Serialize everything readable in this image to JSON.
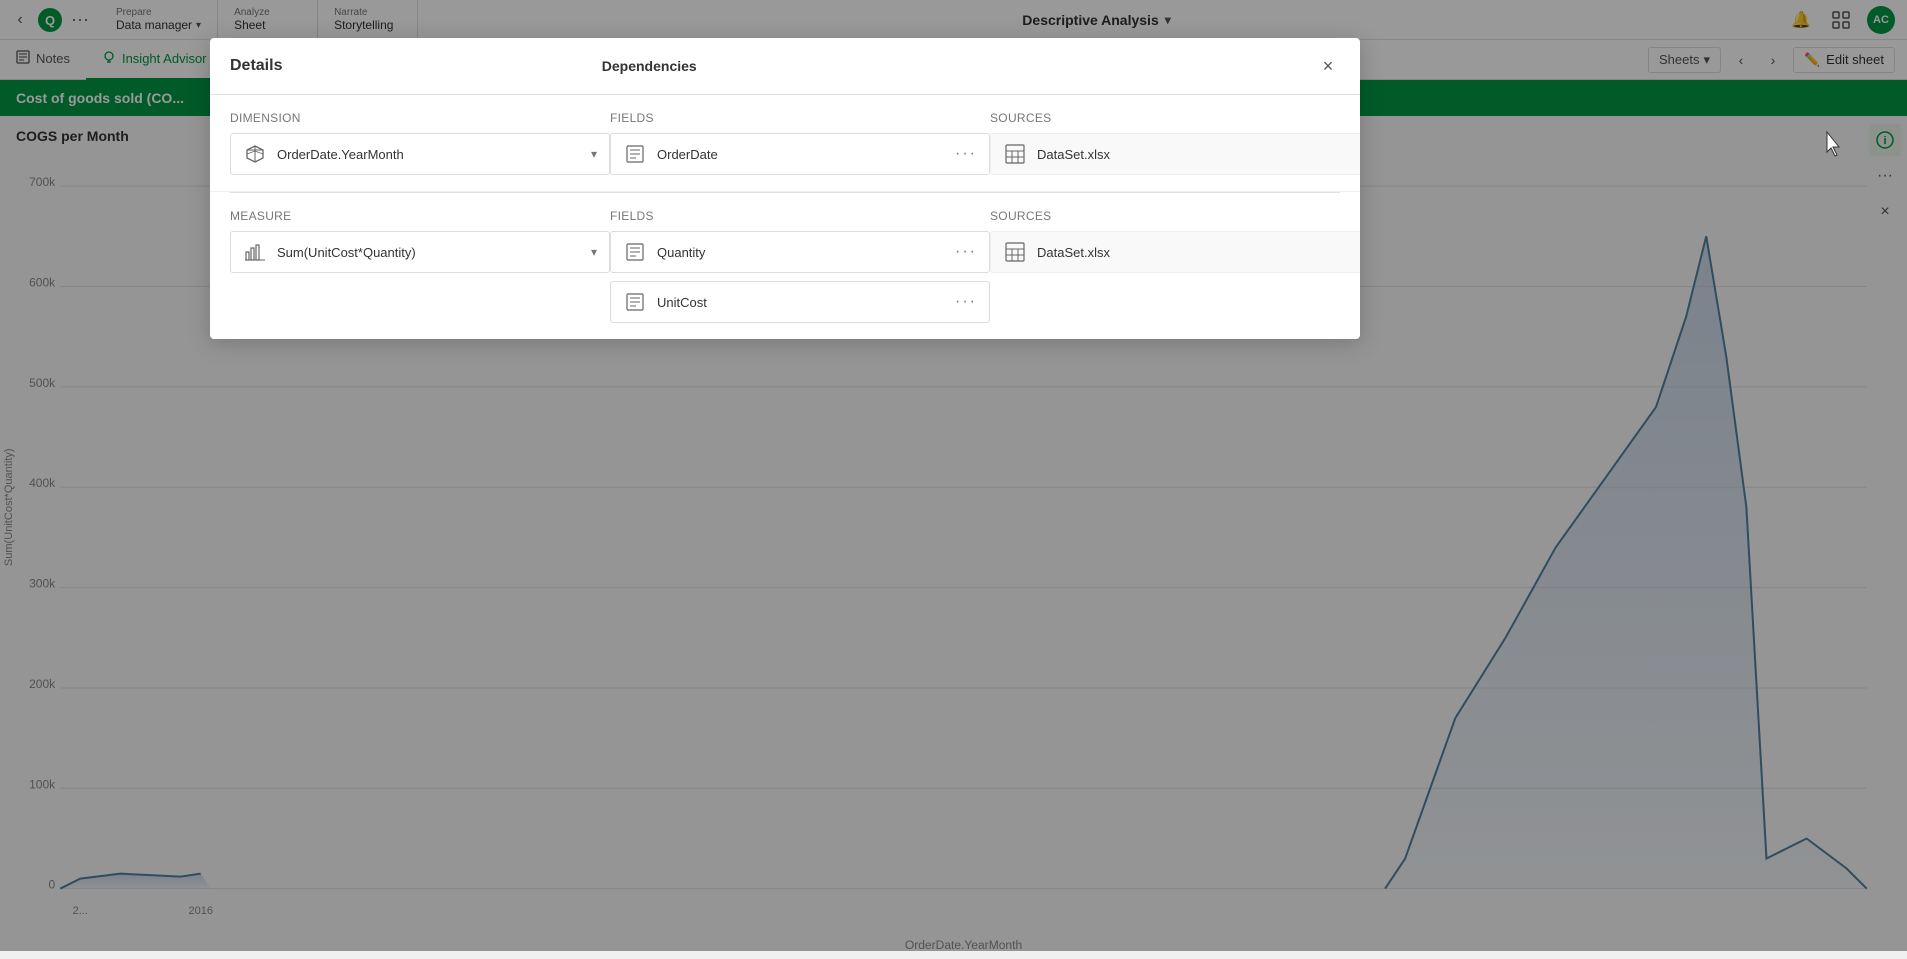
{
  "topNav": {
    "back_icon": "‹",
    "more_icon": "···",
    "sections": [
      {
        "top": "Prepare",
        "bottom": "Data manager",
        "has_chevron": true
      },
      {
        "top": "Analyze",
        "bottom": "Sheet",
        "has_chevron": false
      },
      {
        "top": "Narrate",
        "bottom": "Storytelling",
        "has_chevron": false
      }
    ],
    "title": "Descriptive Analysis",
    "title_chevron": "▾",
    "bell_icon": "🔔",
    "grid_icon": "⊞",
    "avatar": "AC"
  },
  "secondNav": {
    "items": [
      {
        "id": "notes",
        "label": "Notes",
        "icon": "📝",
        "active": false
      },
      {
        "id": "insight-advisor",
        "label": "Insight Advisor",
        "icon": "💡",
        "active": true
      }
    ],
    "sheets_label": "Sheets",
    "sheets_chevron": "▾",
    "edit_sheet_label": "Edit sheet",
    "edit_icon": "✏️"
  },
  "pageTitleBar": {
    "title": "Cost of goods sold (CO..."
  },
  "chartArea": {
    "title": "COGS per Month",
    "y_labels": [
      "700k",
      "600k",
      "500k",
      "400k",
      "300k",
      "200k",
      "100k",
      "0"
    ],
    "x_labels": [
      "2...",
      "2016"
    ],
    "x_axis_label": "OrderDate.YearMonth",
    "y_axis_label": "Sum(UnitCost*Quantity)"
  },
  "modal": {
    "title": "Details",
    "dependencies_label": "Dependencies",
    "close_icon": "×",
    "dimension_section": {
      "label": "Dimension",
      "fields_label": "Fields",
      "sources_label": "Sources",
      "item": {
        "name": "OrderDate.YearMonth",
        "chevron": "▾"
      },
      "fields": [
        {
          "name": "OrderDate",
          "more": "···"
        }
      ],
      "sources": [
        {
          "name": "DataSet.xlsx"
        }
      ]
    },
    "measure_section": {
      "label": "Measure",
      "fields_label": "Fields",
      "sources_label": "Sources",
      "item": {
        "name": "Sum(UnitCost*Quantity)",
        "chevron": "▾"
      },
      "fields": [
        {
          "name": "Quantity",
          "more": "···"
        },
        {
          "name": "UnitCost",
          "more": "···"
        }
      ],
      "sources": [
        {
          "name": "DataSet.xlsx"
        }
      ]
    }
  },
  "rightPanel": {
    "info_icon": "ℹ",
    "more_icon": "···",
    "close_icon": "×"
  }
}
